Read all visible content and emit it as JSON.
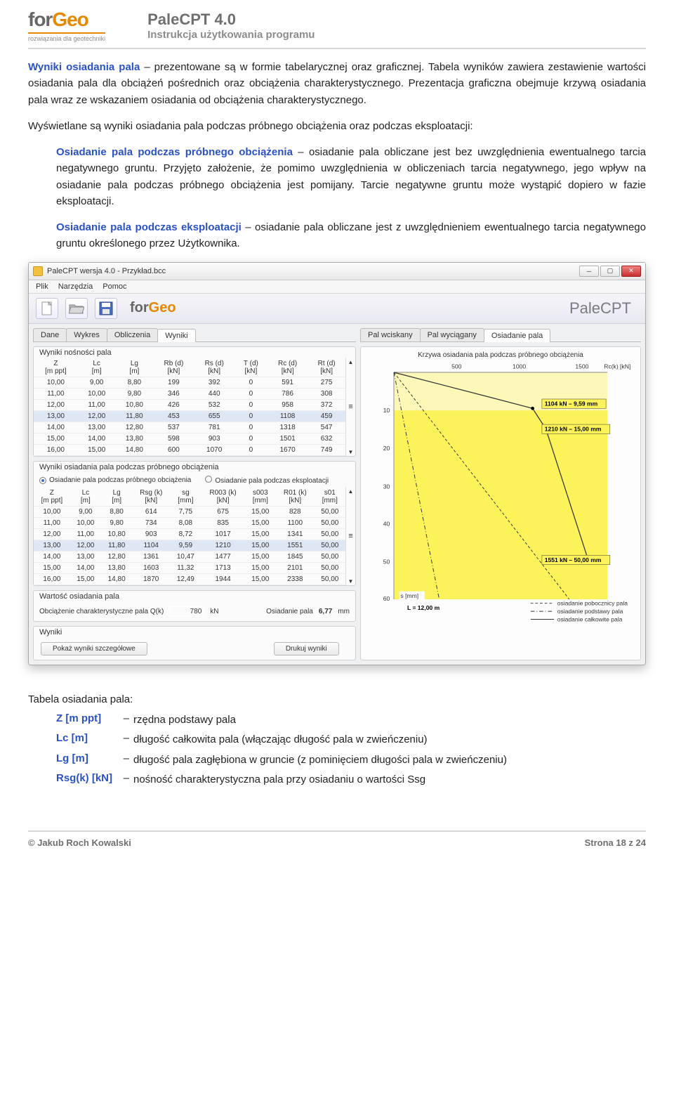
{
  "header": {
    "logo_for": "for",
    "logo_geo": "Geo",
    "logo_sub": "rozwiązania dla geotechniki",
    "title": "PaleCPT 4.0",
    "subtitle": "Instrukcja użytkowania programu"
  },
  "body": {
    "p1a": "Wyniki osiadania pala",
    "p1b": " – prezentowane są w formie tabelarycznej oraz graficznej. Tabela wyników zawiera zestawienie wartości osiadania pala dla obciążeń pośrednich oraz obciążenia charakterystycznego. Prezentacja graficzna obejmuje krzywą osiadania pala wraz ze wskazaniem osiadania od obciążenia charakterystycznego.",
    "p2": "Wyświetlane są wyniki osiadania pala podczas próbnego obciążenia oraz podczas eksploatacji:",
    "pp1a": "Osiadanie pala podczas próbnego obciążenia",
    "pp1b": " – osiadanie pala obliczane jest bez uwzględnienia ewentualnego tarcia negatywnego gruntu. Przyjęto założenie, że pomimo uwzględnienia w obliczeniach tarcia negatywnego, jego wpływ na osiadanie pala podczas próbnego obciążenia jest pomijany. Tarcie negatywne gruntu może wystąpić dopiero w fazie eksploatacji.",
    "pp2a": "Osiadanie pala podczas eksploatacji",
    "pp2b": " – osiadanie pala obliczane jest z uwzględnieniem ewentualnego tarcia negatywnego gruntu określonego przez Użytkownika."
  },
  "screenshot": {
    "title": "PaleCPT wersja 4.0 - Przykład.bcc",
    "menus": [
      "Plik",
      "Narzędzia",
      "Pomoc"
    ],
    "brand": "PaleCPT",
    "tabs_left": [
      "Dane",
      "Wykres",
      "Obliczenia",
      "Wyniki"
    ],
    "tabs_right": [
      "Pal wciskany",
      "Pal wyciągany",
      "Osiadanie pala"
    ],
    "group1_title": "Wyniki nośności pala",
    "table1_headers": [
      "Z\n[m ppt]",
      "Lc\n[m]",
      "Lg\n[m]",
      "Rb (d)\n[kN]",
      "Rs (d)\n[kN]",
      "T (d)\n[kN]",
      "Rc (d)\n[kN]",
      "Rt (d)\n[kN]"
    ],
    "table1_rows": [
      [
        "10,00",
        "9,00",
        "8,80",
        "199",
        "392",
        "0",
        "591",
        "275"
      ],
      [
        "11,00",
        "10,00",
        "9,80",
        "346",
        "440",
        "0",
        "786",
        "308"
      ],
      [
        "12,00",
        "11,00",
        "10,80",
        "426",
        "532",
        "0",
        "958",
        "372"
      ],
      [
        "13,00",
        "12,00",
        "11,80",
        "453",
        "655",
        "0",
        "1108",
        "459"
      ],
      [
        "14,00",
        "13,00",
        "12,80",
        "537",
        "781",
        "0",
        "1318",
        "547"
      ],
      [
        "15,00",
        "14,00",
        "13,80",
        "598",
        "903",
        "0",
        "1501",
        "632"
      ],
      [
        "16,00",
        "15,00",
        "14,80",
        "600",
        "1070",
        "0",
        "1670",
        "749"
      ]
    ],
    "table1_sel": 3,
    "group2_title": "Wyniki osiadania pala podczas próbnego obciążenia",
    "radio1": "Osiadanie pala podczas próbnego obciążenia",
    "radio2": "Osiadanie pala podczas eksploatacji",
    "table2_headers": [
      "Z\n[m ppt]",
      "Lc\n[m]",
      "Lg\n[m]",
      "Rsg (k)\n[kN]",
      "sg\n[mm]",
      "R003 (k)\n[kN]",
      "s003\n[mm]",
      "R01 (k)\n[kN]",
      "s01\n[mm]"
    ],
    "table2_rows": [
      [
        "10,00",
        "9,00",
        "8,80",
        "614",
        "7,75",
        "675",
        "15,00",
        "828",
        "50,00"
      ],
      [
        "11,00",
        "10,00",
        "9,80",
        "734",
        "8,08",
        "835",
        "15,00",
        "1100",
        "50,00"
      ],
      [
        "12,00",
        "11,00",
        "10,80",
        "903",
        "8,72",
        "1017",
        "15,00",
        "1341",
        "50,00"
      ],
      [
        "13,00",
        "12,00",
        "11,80",
        "1104",
        "9,59",
        "1210",
        "15,00",
        "1551",
        "50,00"
      ],
      [
        "14,00",
        "13,00",
        "12,80",
        "1361",
        "10,47",
        "1477",
        "15,00",
        "1845",
        "50,00"
      ],
      [
        "15,00",
        "14,00",
        "13,80",
        "1603",
        "11,32",
        "1713",
        "15,00",
        "2101",
        "50,00"
      ],
      [
        "16,00",
        "15,00",
        "14,80",
        "1870",
        "12,49",
        "1944",
        "15,00",
        "2338",
        "50,00"
      ]
    ],
    "table2_sel": 3,
    "group3_title": "Wartość osiadania pala",
    "vr_label1": "Obciążenie charakterystyczne pala Q(k)",
    "vr_val1": "780",
    "vr_unit1": "kN",
    "vr_label2": "Osiadanie pala",
    "vr_val2": "6,77",
    "vr_unit2": "mm",
    "group4_title": "Wyniki",
    "btn1": "Pokaż wyniki szczegółowe",
    "btn2": "Drukuj wyniki",
    "chart_title": "Krzywa osiadania pala podczas próbnego obciążenia",
    "x_ticks": [
      "500",
      "1000",
      "1500"
    ],
    "x_axis_label": "Rc(k) [kN]",
    "y_ticks": [
      "10",
      "20",
      "30",
      "40",
      "50",
      "60"
    ],
    "y_axis_label": "s [mm]",
    "ann1": "1104 kN – 9,59 mm",
    "ann2": "1210 kN – 15,00 mm",
    "ann3": "1551 kN – 50,00 mm",
    "L_label": "L = 12,00 m",
    "legend": [
      "osiadanie pobocznicy pala",
      "osiadanie podstawy pala",
      "osiadanie całkowite pala"
    ]
  },
  "chart_data": {
    "type": "line",
    "title": "Krzywa osiadania pala podczas próbnego obciążenia",
    "xlabel": "Rc(k) [kN]",
    "ylabel": "s [mm]",
    "xlim": [
      0,
      1700
    ],
    "ylim": [
      0,
      60
    ],
    "y_inverted": true,
    "L": "12,00 m",
    "series": [
      {
        "name": "osiadanie całkowite pala",
        "style": "solid",
        "points": [
          [
            0,
            0
          ],
          [
            780,
            6.77
          ],
          [
            1104,
            9.59
          ],
          [
            1210,
            15.0
          ],
          [
            1551,
            50.0
          ]
        ]
      },
      {
        "name": "osiadanie podstawy pala",
        "style": "dash-dot",
        "points": [
          [
            0,
            0
          ],
          [
            360,
            60
          ]
        ]
      },
      {
        "name": "osiadanie pobocznicy pala",
        "style": "dashed",
        "points": [
          [
            0,
            0
          ],
          [
            1400,
            60
          ]
        ]
      }
    ],
    "annotations": [
      {
        "x": 1104,
        "y": 9.59,
        "text": "1104 kN – 9,59 mm"
      },
      {
        "x": 1210,
        "y": 15.0,
        "text": "1210 kN – 15,00 mm"
      },
      {
        "x": 1551,
        "y": 50.0,
        "text": "1551 kN – 50,00 mm"
      }
    ]
  },
  "defs": {
    "title": "Tabela osiadania pala:",
    "rows": [
      {
        "term": "Z [m ppt]",
        "desc": "rzędna podstawy pala"
      },
      {
        "term": "Lc [m]",
        "desc": "długość całkowita pala (włączając długość pala w zwieńczeniu)"
      },
      {
        "term": "Lg [m]",
        "desc": "długość pala zagłębiona w gruncie (z pominięciem długości pala w zwieńczeniu)"
      },
      {
        "term": "Rsg(k) [kN]",
        "desc": "nośność charakterystyczna pala przy osiadaniu o wartości Ssg"
      }
    ]
  },
  "footer": {
    "left": "© Jakub Roch Kowalski",
    "right": "Strona 18 z 24"
  }
}
